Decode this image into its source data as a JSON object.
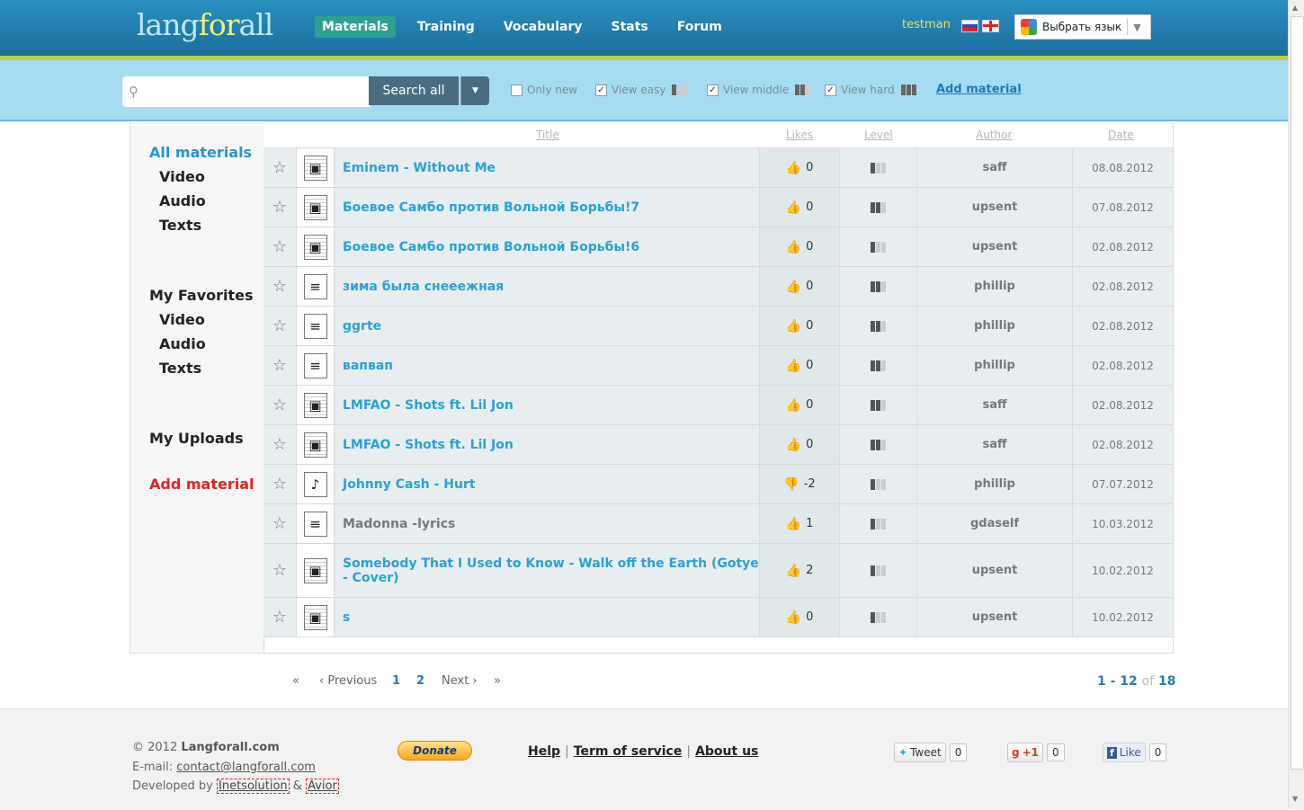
{
  "logo": {
    "part1": "lang",
    "part2": "for",
    "part3": "all"
  },
  "nav": [
    {
      "label": "Materials",
      "active": true
    },
    {
      "label": "Training"
    },
    {
      "label": "Vocabulary"
    },
    {
      "label": "Stats"
    },
    {
      "label": "Forum"
    }
  ],
  "user": {
    "name": "testman"
  },
  "lang_select": {
    "label": "Выбрать язык"
  },
  "search": {
    "placeholder": "",
    "button": "Search all",
    "dropdown_icon": "caret-down-icon"
  },
  "filters": {
    "only_new": {
      "label": "Only new",
      "checked": false
    },
    "view_easy": {
      "label": "View easy",
      "checked": true
    },
    "view_middle": {
      "label": "View middle",
      "checked": true
    },
    "view_hard": {
      "label": "View hard",
      "checked": true
    },
    "add_material": "Add material"
  },
  "sidebar": {
    "all_materials": "All materials",
    "all_items": [
      "Video",
      "Audio",
      "Texts"
    ],
    "favorites": "My Favorites",
    "fav_items": [
      "Video",
      "Audio",
      "Texts"
    ],
    "uploads": "My Uploads",
    "add_material": "Add material"
  },
  "table": {
    "headers": {
      "title": "Title",
      "likes": "Likes",
      "level": "Level",
      "author": "Author",
      "date": "Date"
    },
    "rows": [
      {
        "type": "video",
        "title": "Eminem - Without Me",
        "likes": "0",
        "level": 1,
        "author": "saff",
        "date": "08.08.2012",
        "like_icon": "thumbs-up-icon"
      },
      {
        "type": "video",
        "title": "Боевое Самбо против Вольной Борьбы!7",
        "likes": "0",
        "level": 2,
        "author": "upsent",
        "date": "07.08.2012",
        "like_icon": "thumbs-up-icon"
      },
      {
        "type": "video",
        "title": "Боевое Самбо против Вольной Борьбы!6",
        "likes": "0",
        "level": 1,
        "author": "upsent",
        "date": "02.08.2012",
        "like_icon": "thumbs-up-icon"
      },
      {
        "type": "text",
        "title": "зима была снееежная",
        "likes": "0",
        "level": 2,
        "author": "phillip",
        "date": "02.08.2012",
        "like_icon": "thumbs-up-icon"
      },
      {
        "type": "text",
        "title": "ggrte",
        "likes": "0",
        "level": 2,
        "author": "phillip",
        "date": "02.08.2012",
        "like_icon": "thumbs-up-icon"
      },
      {
        "type": "text",
        "title": "вапвап",
        "likes": "0",
        "level": 2,
        "author": "phillip",
        "date": "02.08.2012",
        "like_icon": "thumbs-up-icon"
      },
      {
        "type": "video",
        "title": "LMFAO - Shots ft. Lil Jon",
        "likes": "0",
        "level": 2,
        "author": "saff",
        "date": "02.08.2012",
        "like_icon": "thumbs-up-icon"
      },
      {
        "type": "video",
        "title": "LMFAO - Shots ft. Lil Jon",
        "likes": "0",
        "level": 2,
        "author": "saff",
        "date": "02.08.2012",
        "like_icon": "thumbs-up-icon"
      },
      {
        "type": "audio",
        "title": "Johnny Cash - Hurt",
        "likes": "-2",
        "level": 1,
        "author": "phillip",
        "date": "07.07.2012",
        "like_icon": "thumbs-down-icon"
      },
      {
        "type": "text",
        "title": "Madonna -lyrics",
        "likes": "1",
        "level": 1,
        "author": "gdaself",
        "date": "10.03.2012",
        "like_icon": "thumbs-up-icon",
        "gray": true
      },
      {
        "type": "video",
        "title": "Somebody That I Used to Know - Walk off the Earth (Gotye - Cover)",
        "likes": "2",
        "level": 1,
        "author": "upsent",
        "date": "10.02.2012",
        "like_icon": "thumbs-up-icon",
        "tall": true
      },
      {
        "type": "video",
        "title": "s",
        "likes": "0",
        "level": 1,
        "author": "upsent",
        "date": "10.02.2012",
        "like_icon": "thumbs-up-icon"
      }
    ]
  },
  "pagination": {
    "first": "«",
    "prev": "‹ Previous",
    "pages": [
      "1",
      "2"
    ],
    "next": "Next ›",
    "last": "»",
    "range": "1 - 12",
    "of": "of",
    "total": "18"
  },
  "footer": {
    "copyright_prefix": "© 2012",
    "site": "Langforall.com",
    "email_label": "E-mail:",
    "email": "contact@langforall.com",
    "dev_prefix": "Developed by",
    "dev1": "Inetsolution",
    "dev_amp": "&",
    "dev2": "Avior",
    "donate": "Donate",
    "links": [
      "Help",
      "Term of service",
      "About us"
    ],
    "tweet": "Tweet",
    "tweet_count": "0",
    "gplus": "+1",
    "gplus_count": "0",
    "like": "Like",
    "like_count": "0"
  }
}
